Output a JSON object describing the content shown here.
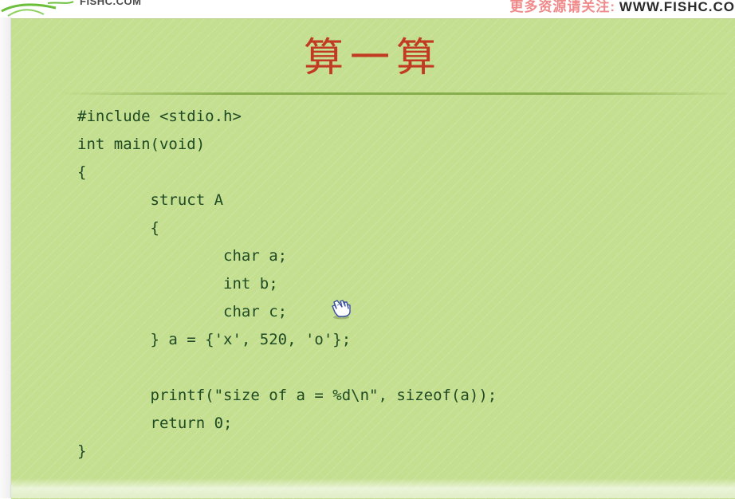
{
  "header": {
    "logo_text": "FISHC.COM",
    "promo_label": "更多资源请关注:",
    "promo_url": "WWW.FISHC.CO"
  },
  "slide": {
    "title": "算一算",
    "code_lines": [
      "#include <stdio.h>",
      "int main(void)",
      "{",
      "        struct A",
      "        {",
      "                char a;",
      "                int b;",
      "                char c;",
      "        } a = {'x', 520, 'o'};",
      "",
      "        printf(\"size of a = %d\\n\", sizeof(a));",
      "        return 0;",
      "}"
    ]
  },
  "icons": {
    "cursor": "hand-pointer-icon"
  },
  "colors": {
    "slide_bg": "#c3df8f",
    "title": "#c23a22",
    "code": "#1f4a24",
    "promo_cn": "#f08a8a"
  }
}
